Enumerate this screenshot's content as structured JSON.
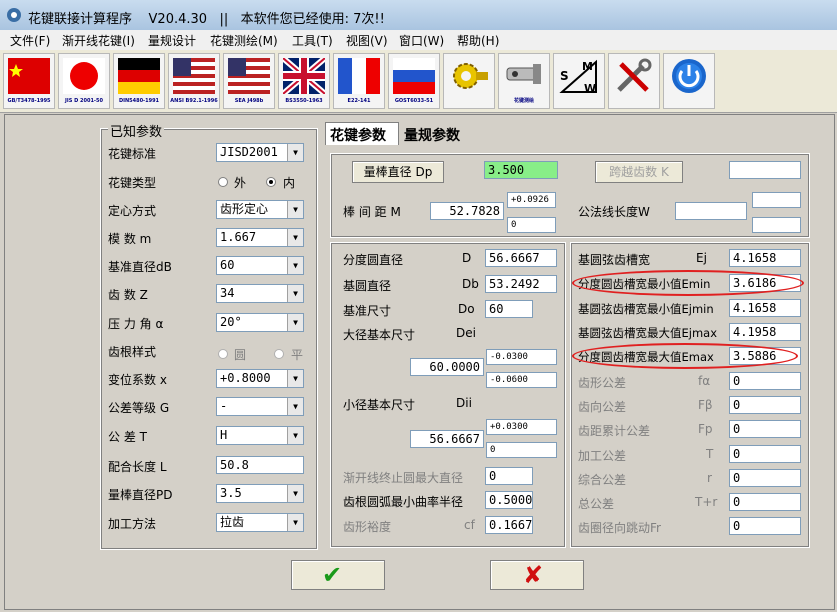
{
  "titlebar": {
    "title": "花键联接计算程序    V20.4.30   ||   本软件您已经使用: 7次!!"
  },
  "menu": [
    "文件(F)",
    "渐开线花键(I)",
    "量规设计",
    "花键测绘(M)",
    "工具(T)",
    "视图(V)",
    "窗口(W)",
    "帮助(H)"
  ],
  "toolbar": [
    {
      "icon": "china-flag-icon",
      "caption": "GB/T3478-1995"
    },
    {
      "icon": "japan-flag-icon",
      "caption": "JIS D 2001-50"
    },
    {
      "icon": "germany-flag-icon",
      "caption": "DIN5480-1991"
    },
    {
      "icon": "usa-flag-icon",
      "caption": "ANSI B92.1-1996"
    },
    {
      "icon": "usa-flag-icon",
      "caption": "SEA J498b"
    },
    {
      "icon": "uk-flag-icon",
      "caption": "BS3550-1963"
    },
    {
      "icon": "france-flag-icon",
      "caption": "E22-141"
    },
    {
      "icon": "russia-flag-icon",
      "caption": "GOST6033-51"
    },
    {
      "icon": "gear-tool-icon",
      "caption": ""
    },
    {
      "icon": "measure-icon",
      "caption": "花键测绘"
    },
    {
      "icon": "smw-icon",
      "caption": ""
    },
    {
      "icon": "tools-icon",
      "caption": ""
    },
    {
      "icon": "power-icon",
      "caption": ""
    }
  ],
  "known": {
    "title": "已知参数",
    "standard_label": "花键标准",
    "standard": "JISD2001",
    "type_label": "花键类型",
    "type_opts": [
      "外",
      "内"
    ],
    "type_selected": "内",
    "center_label": "定心方式",
    "center": "齿形定心",
    "module_label": "模      数 m",
    "module": "1.667",
    "base_dia_label": "基准直径dB",
    "base_dia": "60",
    "teeth_label": "齿      数 Z",
    "teeth": "34",
    "pressure_label": "压 力 角 α",
    "pressure": "20°",
    "root_label": "齿根样式",
    "root_opts": [
      "圆",
      "平"
    ],
    "shift_label": "变位系数 x",
    "shift": "+0.8000",
    "tol_grade_label": "公差等级 G",
    "tol_grade": "-",
    "tol_label": "公      差  T",
    "tol": "H",
    "fit_len_label": "配合长度 L",
    "fit_len": "50.8",
    "pin_dia_label": "量棒直径PD",
    "pin_dia": "3.5",
    "method_label": "加工方法",
    "method": "拉齿"
  },
  "tabs": [
    "花键参数",
    "量规参数"
  ],
  "top": {
    "pin_btn": "量棒直径 Dp",
    "pin_val": "3.500",
    "over_label": "棒 间 距  M",
    "over_val": "52.7828",
    "over_up": "+0.0926",
    "over_lo": "0",
    "span_btn": "跨越齿数  K",
    "span_val": "",
    "chord_label": "公法线长度W",
    "chord_val": "",
    "chord_up": "",
    "chord_lo": ""
  },
  "left": {
    "pitch_label": "分度圆直径",
    "pitch_sym": "D",
    "pitch": "56.6667",
    "base_label": "基圆直径",
    "base_sym": "Db",
    "base": "53.2492",
    "ref_label": "基准尺寸",
    "ref_sym": "Do",
    "ref": "60",
    "major_label": "大径基本尺寸",
    "major_sym": "Dei",
    "major": "60.0000",
    "major_up": "-0.0300",
    "major_lo": "-0.0600",
    "minor_label": "小径基本尺寸",
    "minor_sym": "Dii",
    "minor": "56.6667",
    "minor_up": "+0.0300",
    "minor_lo": "0",
    "form_label": "渐开线终止圆最大直径",
    "form": "0",
    "fillet_label": "齿根圆弧最小曲率半径",
    "fillet": "0.5000",
    "clear_label": "齿形裕度",
    "clear_sym": "cf",
    "clear": "0.1667"
  },
  "right": {
    "ej_label": "基圆弦齿槽宽",
    "ej_sym": "Ej",
    "ej": "4.1658",
    "emin_label": "分度圆齿槽宽最小值Emin",
    "emin": "3.6186",
    "ejmin_label": "基圆弦齿槽宽最小值Ejmin",
    "ejmin": "4.1658",
    "ejmax_label": "基圆弦齿槽宽最大值Ejmax",
    "ejmax": "4.1958",
    "emax_label": "分度圆齿槽宽最大值Emax",
    "emax": "3.5886",
    "tols": [
      {
        "label": "齿形公差",
        "sym": "fα",
        "val": "0"
      },
      {
        "label": "齿向公差",
        "sym": "Fβ",
        "val": "0"
      },
      {
        "label": "齿距累计公差",
        "sym": "Fp",
        "val": "0"
      },
      {
        "label": "加工公差",
        "sym": "T",
        "val": "0"
      },
      {
        "label": "综合公差",
        "sym": "r",
        "val": "0"
      },
      {
        "label": "总公差",
        "sym": "T+r",
        "val": "0"
      },
      {
        "label": "齿圈径向跳动Fr",
        "sym": "",
        "val": "0"
      }
    ]
  },
  "buttons": {
    "ok": "✔",
    "cancel": "✘"
  }
}
